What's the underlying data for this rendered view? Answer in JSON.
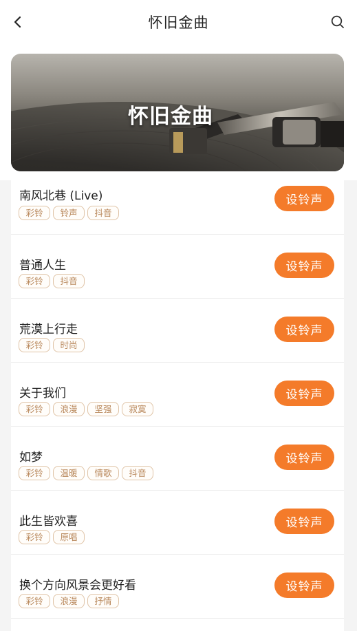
{
  "header": {
    "title": "怀旧金曲",
    "back_icon": "chevron-left-icon",
    "search_icon": "search-icon"
  },
  "banner": {
    "title": "怀旧金曲"
  },
  "colors": {
    "accent": "#f47b2a",
    "tag_text": "#b8875a",
    "tag_border": "#dfc3a6"
  },
  "songs": [
    {
      "name": "南风北巷 (Live)",
      "tags": [
        "彩铃",
        "铃声",
        "抖音"
      ],
      "button": "设铃声"
    },
    {
      "name": "普通人生",
      "tags": [
        "彩铃",
        "抖音"
      ],
      "button": "设铃声"
    },
    {
      "name": "荒漠上行走",
      "tags": [
        "彩铃",
        "时尚"
      ],
      "button": "设铃声"
    },
    {
      "name": "关于我们",
      "tags": [
        "彩铃",
        "浪漫",
        "坚强",
        "寂寞"
      ],
      "button": "设铃声"
    },
    {
      "name": "如梦",
      "tags": [
        "彩铃",
        "温暖",
        "情歌",
        "抖音"
      ],
      "button": "设铃声"
    },
    {
      "name": "此生皆欢喜",
      "tags": [
        "彩铃",
        "原唱"
      ],
      "button": "设铃声"
    },
    {
      "name": "换个方向风景会更好看",
      "tags": [
        "彩铃",
        "浪漫",
        "抒情"
      ],
      "button": "设铃声"
    }
  ]
}
